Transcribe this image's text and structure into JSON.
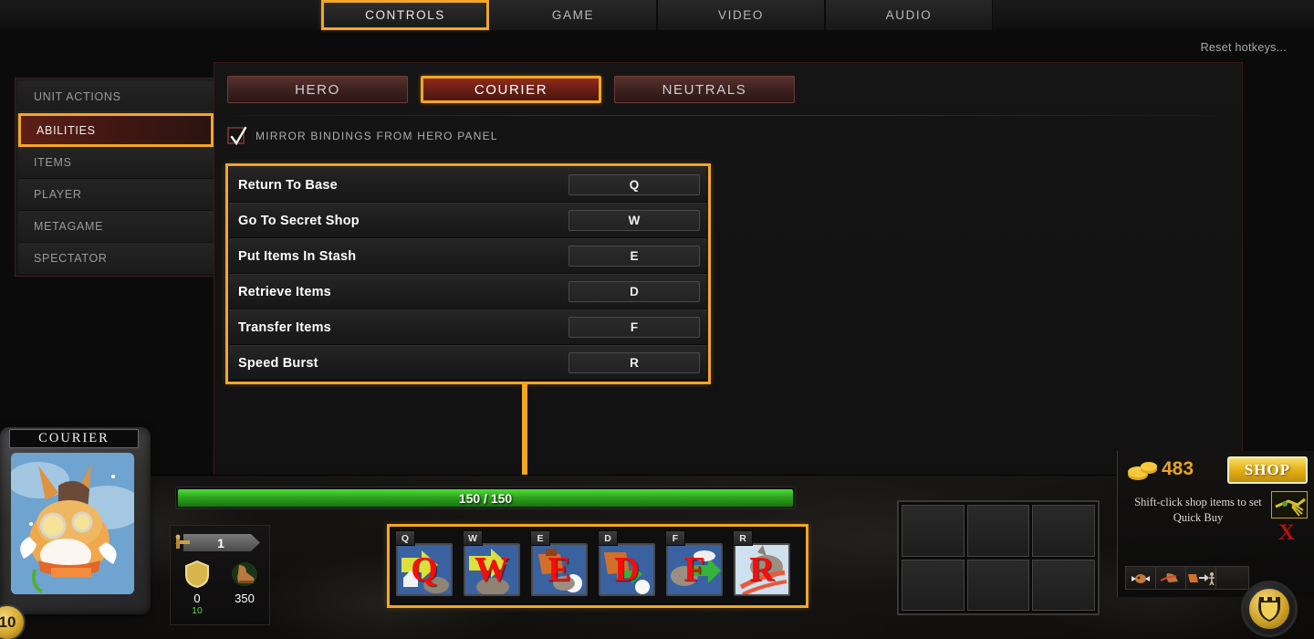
{
  "top_tabs": [
    {
      "label": "CONTROLS",
      "selected": true
    },
    {
      "label": "GAME",
      "selected": false
    },
    {
      "label": "VIDEO",
      "selected": false
    },
    {
      "label": "AUDIO",
      "selected": false
    }
  ],
  "reset_link": "Reset hotkeys...",
  "sidebar": {
    "items": [
      {
        "label": "UNIT ACTIONS",
        "selected": false
      },
      {
        "label": "ABILITIES",
        "selected": true
      },
      {
        "label": "ITEMS",
        "selected": false
      },
      {
        "label": "PLAYER",
        "selected": false
      },
      {
        "label": "METAGAME",
        "selected": false
      },
      {
        "label": "SPECTATOR",
        "selected": false
      }
    ]
  },
  "sub_tabs": [
    {
      "label": "HERO",
      "selected": false
    },
    {
      "label": "COURIER",
      "selected": true
    },
    {
      "label": "NEUTRALS",
      "selected": false
    }
  ],
  "mirror_checkbox": {
    "label": "MIRROR BINDINGS FROM HERO PANEL",
    "checked": true
  },
  "bindings": [
    {
      "action": "Return To Base",
      "key": "Q"
    },
    {
      "action": "Go To Secret Shop",
      "key": "W"
    },
    {
      "action": "Put Items In Stash",
      "key": "E"
    },
    {
      "action": "Retrieve Items",
      "key": "D"
    },
    {
      "action": "Transfer Items",
      "key": "F"
    },
    {
      "action": "Speed Burst",
      "key": "R"
    }
  ],
  "hud": {
    "unit_name": "COURIER",
    "level": "10",
    "health": "150 / 150",
    "stats": {
      "attack": "1",
      "armor": "0",
      "armor_bonus": "10",
      "move_speed": "350"
    },
    "abilities": [
      {
        "hotkey": "Q",
        "letter": "Q",
        "name": "return-to-base-ability"
      },
      {
        "hotkey": "W",
        "letter": "W",
        "name": "go-to-secret-shop-ability"
      },
      {
        "hotkey": "E",
        "letter": "E",
        "name": "put-items-in-stash-ability"
      },
      {
        "hotkey": "D",
        "letter": "D",
        "name": "retrieve-items-ability"
      },
      {
        "hotkey": "F",
        "letter": "F",
        "name": "transfer-items-ability"
      },
      {
        "hotkey": "R",
        "letter": "R",
        "name": "speed-burst-ability"
      }
    ],
    "inventory_slots": [
      "",
      "",
      "",
      "",
      "",
      ""
    ],
    "shop": {
      "gold": "483",
      "shop_label": "SHOP",
      "quickbuy_hint": "Shift-click shop items to set Quick Buy"
    }
  },
  "colors": {
    "highlight": "#f5a623",
    "selected_tab_red": "#8e2a1c",
    "gold": "#e8a227",
    "health_green": "#2ea61e",
    "ability_letter_red": "#fb0b0b"
  }
}
